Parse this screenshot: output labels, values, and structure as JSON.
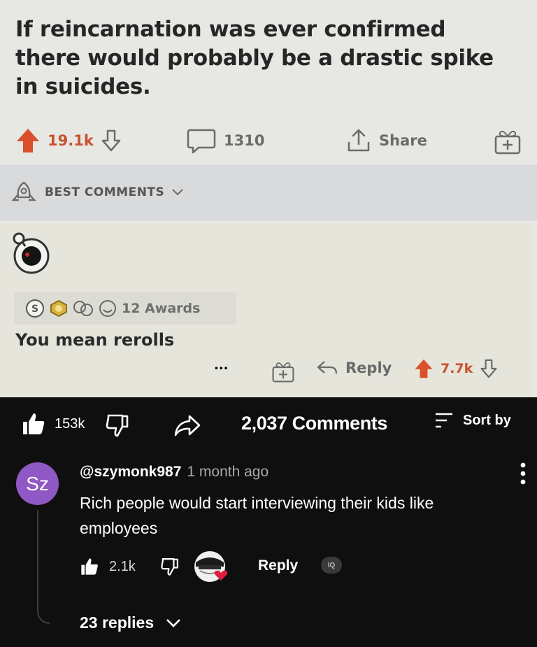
{
  "reddit": {
    "post_title": "If reincarnation was ever confirmed there would probably be a drastic spike in suicides.",
    "upvotes": "19.1k",
    "comments_count": "1310",
    "share_label": "Share",
    "best_comments_label": "BEST COMMENTS",
    "awards_label": "12 Awards",
    "comment_text": "You mean rerolls",
    "more_label": "...",
    "reply_label": "Reply",
    "comment_votes": "7.7k",
    "accent_color": "#d9502a"
  },
  "youtube": {
    "likes": "153k",
    "comments_title": "2,037 Comments",
    "sort_label": "Sort by",
    "comment": {
      "avatar_initials": "Sz",
      "avatar_color": "#8f58c4",
      "username": "@szymonk987",
      "time": "1 month ago",
      "text": "Rich people would start interviewing their kids like employees",
      "likes": "2.1k",
      "reply_label": "Reply",
      "badge_text": "IQ",
      "replies_label": "23 replies"
    }
  }
}
